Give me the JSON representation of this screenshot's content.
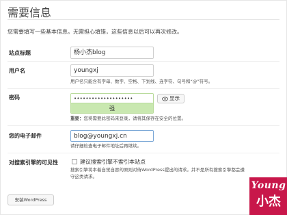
{
  "page": {
    "title": "需要信息",
    "intro": "您需要填写一些基本信息。无需担心填错，这些信息以后可以再次修改。"
  },
  "site_title": {
    "label": "站点标题",
    "value": "杨小杰blog"
  },
  "username": {
    "label": "用户名",
    "value": "youngxj",
    "hint": "用户名只能含有字母、数字、空格、下划线、连字符、句号和“@”符号。"
  },
  "password": {
    "label": "密码",
    "masked_value": "••••••••••••••••••••",
    "strength": "强",
    "show_button": "显示",
    "hint_strong": "重要：",
    "hint_rest": "您将需要此密码来登录，请将其保存在安全的位置。"
  },
  "email": {
    "label": "您的电子邮件",
    "value": "blog@youngxj.cn",
    "hint": "请仔细检查电子邮件地址后再继续。"
  },
  "search_visibility": {
    "label": "对搜索引擎的可见性",
    "checkbox_label": "建议搜索引擎不索引本站点",
    "checked": false,
    "hint": "搜索引擎将本着自觉自愿的原则对待WordPress提出的请求。并不是所有搜索引擎都会遵守这类请求。"
  },
  "install_button": "安装WordPress",
  "stamp": {
    "line1": "Young",
    "line2": "小杰",
    "color": "#c8174a"
  },
  "colors": {
    "strength_bg": "#c9e8b0",
    "strength_border": "#b9db9b",
    "field_border": "#cfcfcf"
  }
}
